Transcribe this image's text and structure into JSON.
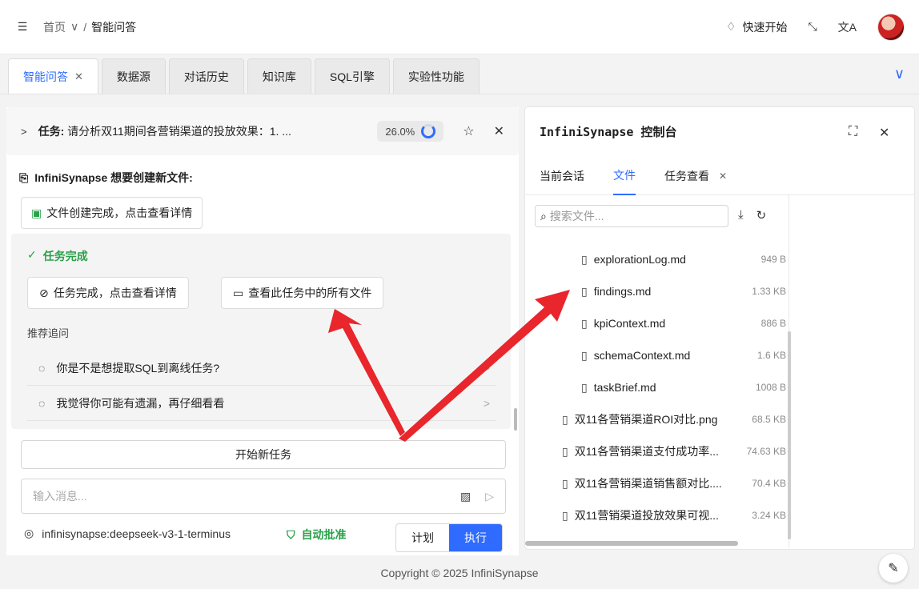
{
  "header": {
    "breadcrumb_home": "首页",
    "breadcrumb_sep": "/",
    "breadcrumb_current": "智能问答",
    "quick_start": "快速开始"
  },
  "tabs": [
    {
      "label": "智能问答",
      "active": true
    },
    {
      "label": "数据源"
    },
    {
      "label": "对话历史"
    },
    {
      "label": "知识库"
    },
    {
      "label": "SQL引擎"
    },
    {
      "label": "实验性功能"
    }
  ],
  "task": {
    "prefix": "任务:",
    "text": "请分析双11期间各营销渠道的投放效果：1. ...",
    "progress": "26.0%"
  },
  "left": {
    "create_file_title": "InfiniSynapse 想要创建新文件:",
    "file_created_btn": "文件创建完成，点击查看详情",
    "task_done": "任务完成",
    "task_done_btn": "任务完成，点击查看详情",
    "view_files_btn": "查看此任务中的所有文件",
    "suggest_label": "推荐追问",
    "suggestions": [
      "你是不是想提取SQL到离线任务?",
      "我觉得你可能有遗漏，再仔细看看"
    ],
    "new_task": "开始新任务",
    "input_placeholder": "输入消息...",
    "model": "infinisynapse:deepseek-v3-1-terminus",
    "auto_approve": "自动批准",
    "mode_plan": "计划",
    "mode_exec": "执行"
  },
  "right": {
    "title_en": "InfiniSynapse",
    "title_cn": "控制台",
    "tabs": [
      "当前会话",
      "文件",
      "任务查看"
    ],
    "search_placeholder": "搜索文件...",
    "files": [
      {
        "name": "explorationLog.md",
        "size": "949 B"
      },
      {
        "name": "findings.md",
        "size": "1.33 KB"
      },
      {
        "name": "kpiContext.md",
        "size": "886 B"
      },
      {
        "name": "schemaContext.md",
        "size": "1.6 KB"
      },
      {
        "name": "taskBrief.md",
        "size": "1008 B"
      },
      {
        "name": "双11各营销渠道ROI对比.png",
        "size": "68.5 KB"
      },
      {
        "name": "双11各营销渠道支付成功率...",
        "size": "74.63 KB"
      },
      {
        "name": "双11各营销渠道销售额对比....",
        "size": "70.4 KB"
      },
      {
        "name": "双11营销渠道投放效果可视...",
        "size": "3.24 KB"
      }
    ]
  },
  "footer": "Copyright © 2025 InfiniSynapse",
  "colors": {
    "accent": "#2f6bff",
    "success": "#2aa04a",
    "arrow": "#e8262b"
  },
  "icons": [
    "menu-icon",
    "bell-icon",
    "fullscreen-icon",
    "translate-icon",
    "close-icon",
    "star-icon",
    "file-icon",
    "folder-icon",
    "image-icon",
    "send-icon",
    "download-icon",
    "refresh-icon",
    "search-icon",
    "chat-icon"
  ]
}
